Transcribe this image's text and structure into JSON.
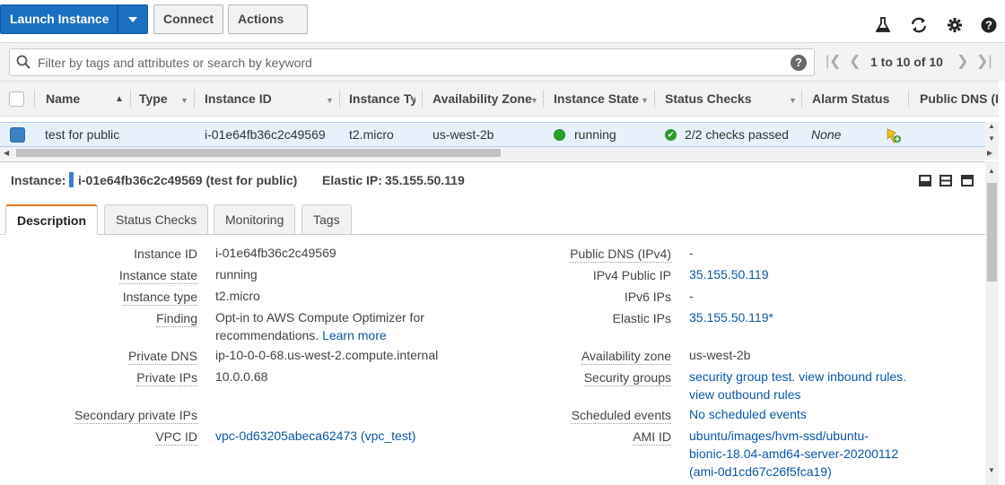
{
  "toolbar": {
    "launch_label": "Launch Instance",
    "connect_label": "Connect",
    "actions_label": "Actions",
    "icons": [
      "flask-icon",
      "refresh-icon",
      "gear-icon",
      "help-icon"
    ]
  },
  "filter": {
    "placeholder": "Filter by tags and attributes or search by keyword",
    "help": "?",
    "pagination": "1 to 10 of 10"
  },
  "table": {
    "columns": [
      "Name",
      "Type",
      "Instance ID",
      "Instance Ty",
      "Availability Zone",
      "Instance State",
      "Status Checks",
      "Alarm Status",
      "Public DNS (IP"
    ],
    "row": {
      "name": "test for public",
      "instance_id": "i-01e64fb36c2c49569",
      "instance_type": "t2.micro",
      "availability_zone": "us-west-2b",
      "state": "running",
      "status_checks": "2/2 checks passed",
      "alarm_status": "None"
    }
  },
  "details": {
    "instance_label": "Instance:",
    "instance_value": "i-01e64fb36c2c49569 (test for public)",
    "elastic_label": "Elastic IP:",
    "elastic_value": "35.155.50.119",
    "tabs": [
      "Description",
      "Status Checks",
      "Monitoring",
      "Tags"
    ],
    "left": {
      "instance_id_label": "Instance ID",
      "instance_id": "i-01e64fb36c2c49569",
      "instance_state_label": "Instance state",
      "instance_state": "running",
      "instance_type_label": "Instance type",
      "instance_type": "t2.micro",
      "finding_label": "Finding",
      "finding_text": "Opt-in to AWS Compute Optimizer for recommendations.",
      "finding_link": "Learn more",
      "private_dns_label": "Private DNS",
      "private_dns": "ip-10-0-0-68.us-west-2.compute.internal",
      "private_ips_label": "Private IPs",
      "private_ips": "10.0.0.68",
      "secondary_label": "Secondary private IPs",
      "vpc_label": "VPC ID",
      "vpc_id": "vpc-0d63205abeca62473 (vpc_test)"
    },
    "right": {
      "public_dns_label": "Public DNS (IPv4)",
      "public_dns": "-",
      "ipv4_label": "IPv4 Public IP",
      "ipv4": "35.155.50.119",
      "ipv6_label": "IPv6 IPs",
      "ipv6": "-",
      "elastic_ips_label": "Elastic IPs",
      "elastic_ips": "35.155.50.119*",
      "az_label": "Availability zone",
      "az": "us-west-2b",
      "sg_label": "Security groups",
      "sg_link1": "security group test.",
      "sg_link2": "view inbound rules.",
      "sg_link3": "view outbound rules",
      "sched_label": "Scheduled events",
      "sched": "No scheduled events",
      "ami_label": "AMI ID",
      "ami": "ubuntu/images/hvm-ssd/ubuntu-bionic-18.04-amd64-server-20200112 (ami-0d1cd67c26f5fca19)"
    }
  }
}
